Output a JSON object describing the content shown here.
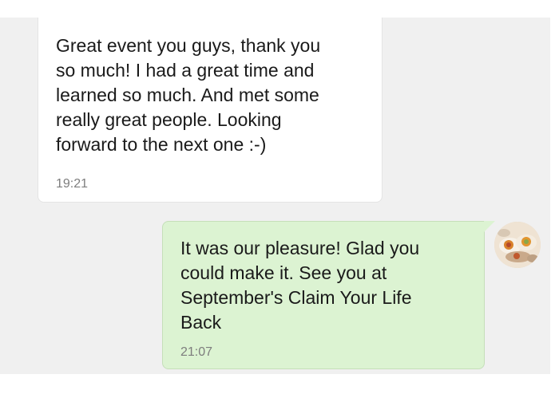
{
  "messages": [
    {
      "direction": "incoming",
      "text": "Great event you guys, thank you\nso much! I had a great time and\nlearned so much. And met some\nreally great people. Looking\nforward to the next one :-)",
      "time": "19:21"
    },
    {
      "direction": "outgoing",
      "text": "It was our pleasure! Glad you\ncould make it. See you at\nSeptember's Claim Your Life\nBack",
      "time": "21:07"
    }
  ],
  "avatar": {
    "icon": "user-avatar-photo"
  },
  "colors": {
    "chat_background": "#f0f0f0",
    "incoming_bubble": "#ffffff",
    "outgoing_bubble": "#dcf3d2",
    "timestamp": "#7d7d7d"
  }
}
